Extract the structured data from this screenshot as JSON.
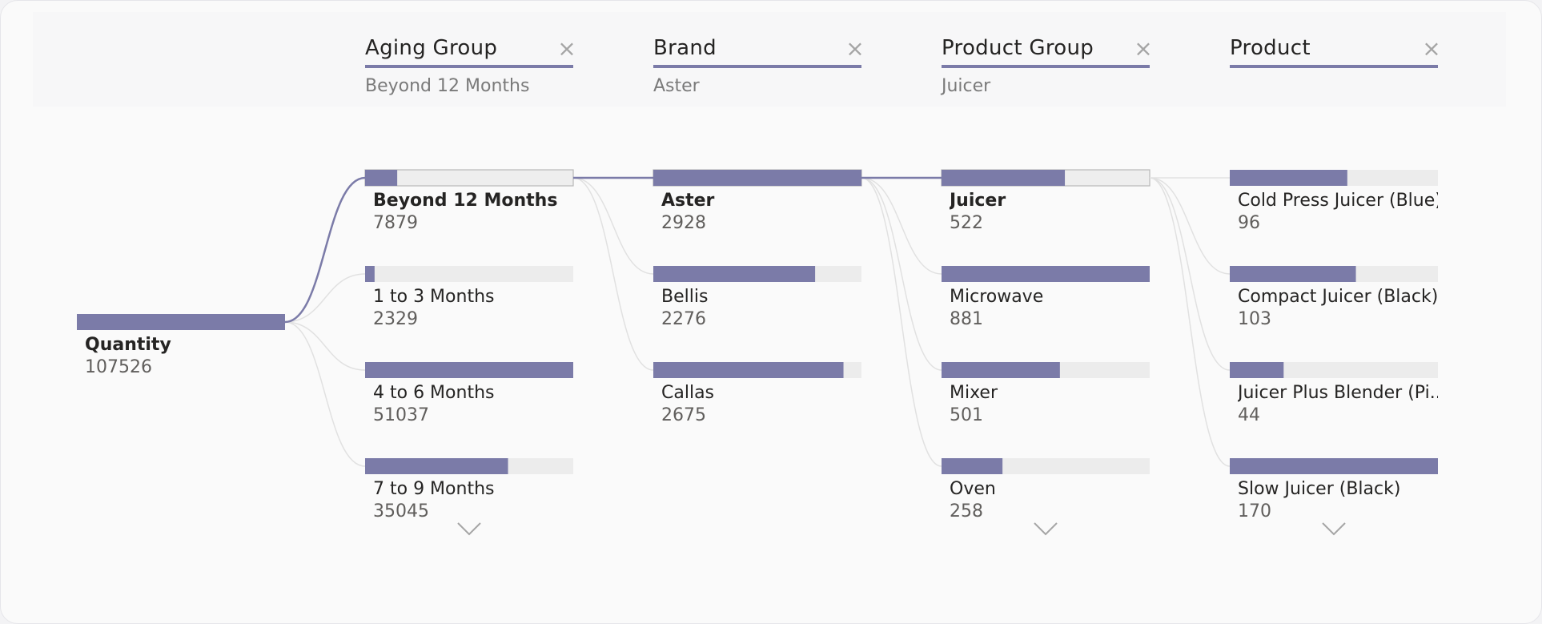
{
  "chart_data": {
    "type": "decomposition_tree",
    "root": {
      "label": "Quantity",
      "value": 107526
    },
    "levels": [
      {
        "header": "Aging Group",
        "selected": "Beyond 12 Months",
        "more_below": true,
        "nodes": [
          {
            "label": "Beyond 12 Months",
            "value": 7879
          },
          {
            "label": "1 to 3 Months",
            "value": 2329
          },
          {
            "label": "4 to 6 Months",
            "value": 51037
          },
          {
            "label": "7 to 9 Months",
            "value": 35045
          }
        ]
      },
      {
        "header": "Brand",
        "selected": "Aster",
        "more_below": false,
        "nodes": [
          {
            "label": "Aster",
            "value": 2928
          },
          {
            "label": "Bellis",
            "value": 2276
          },
          {
            "label": "Callas",
            "value": 2675
          }
        ]
      },
      {
        "header": "Product Group",
        "selected": "Juicer",
        "more_below": true,
        "nodes": [
          {
            "label": "Juicer",
            "value": 522
          },
          {
            "label": "Microwave",
            "value": 881
          },
          {
            "label": "Mixer",
            "value": 501
          },
          {
            "label": "Oven",
            "value": 258
          }
        ]
      },
      {
        "header": "Product",
        "selected": null,
        "more_below": true,
        "nodes": [
          {
            "label": "Cold Press Juicer (Blue)",
            "value": 96
          },
          {
            "label": "Compact Juicer (Black)",
            "value": 103
          },
          {
            "label": "Juicer Plus Blender (Pi...",
            "value": 44
          },
          {
            "label": "Slow Juicer (Black)",
            "value": 170
          }
        ]
      }
    ]
  },
  "colors": {
    "bar_fill": "#7b7ba8",
    "bar_track": "#ececec",
    "selected_track": "#eeeeee",
    "selected_border": "#b8b8b8",
    "connector_active": "#7b7ba8",
    "connector_inactive": "#e1e1e1",
    "header_line": "#7b7ba8",
    "close_icon": "#a5a5a5",
    "chevron_icon": "#a5a5a5"
  },
  "icons": {
    "close": "close-icon",
    "expand": "chevron-down-icon"
  }
}
